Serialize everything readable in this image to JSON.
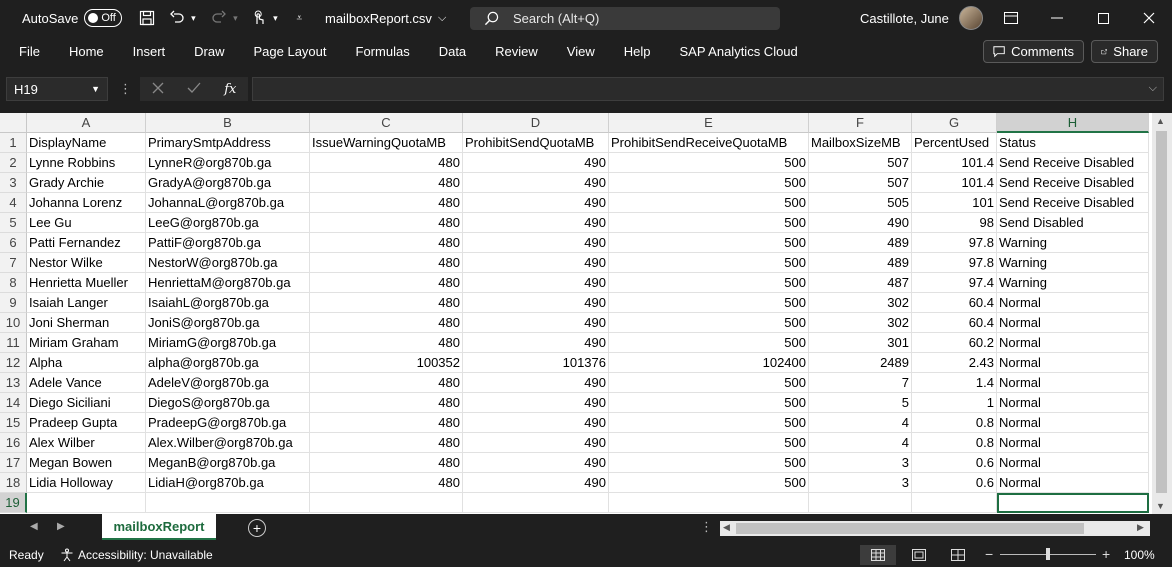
{
  "titlebar": {
    "autosave_label": "AutoSave",
    "autosave_state": "Off",
    "filename": "mailboxReport.csv",
    "search_placeholder": "Search (Alt+Q)",
    "user_name": "Castillote, June"
  },
  "menu": {
    "items": [
      "File",
      "Home",
      "Insert",
      "Draw",
      "Page Layout",
      "Formulas",
      "Data",
      "Review",
      "View",
      "Help",
      "SAP Analytics Cloud"
    ],
    "comments_label": "Comments",
    "share_label": "Share"
  },
  "formula_bar": {
    "name_box": "H19",
    "formula": ""
  },
  "sheet": {
    "columns": [
      "A",
      "B",
      "C",
      "D",
      "E",
      "F",
      "G",
      "H"
    ],
    "selected_column": "H",
    "row_numbers": [
      "1",
      "2",
      "3",
      "4",
      "5",
      "6",
      "7",
      "8",
      "9",
      "10",
      "11",
      "12",
      "13",
      "14",
      "15",
      "16",
      "17",
      "18",
      "19"
    ],
    "selected_row": "19",
    "rows": [
      [
        "DisplayName",
        "PrimarySmtpAddress",
        "IssueWarningQuotaMB",
        "ProhibitSendQuotaMB",
        "ProhibitSendReceiveQuotaMB",
        "MailboxSizeMB",
        "PercentUsed",
        "Status"
      ],
      [
        "Lynne Robbins",
        "LynneR@org870b.ga",
        "480",
        "490",
        "500",
        "507",
        "101.4",
        "Send Receive Disabled"
      ],
      [
        "Grady Archie",
        "GradyA@org870b.ga",
        "480",
        "490",
        "500",
        "507",
        "101.4",
        "Send Receive Disabled"
      ],
      [
        "Johanna Lorenz",
        "JohannaL@org870b.ga",
        "480",
        "490",
        "500",
        "505",
        "101",
        "Send Receive Disabled"
      ],
      [
        "Lee Gu",
        "LeeG@org870b.ga",
        "480",
        "490",
        "500",
        "490",
        "98",
        "Send Disabled"
      ],
      [
        "Patti Fernandez",
        "PattiF@org870b.ga",
        "480",
        "490",
        "500",
        "489",
        "97.8",
        "Warning"
      ],
      [
        "Nestor Wilke",
        "NestorW@org870b.ga",
        "480",
        "490",
        "500",
        "489",
        "97.8",
        "Warning"
      ],
      [
        "Henrietta Mueller",
        "HenriettaM@org870b.ga",
        "480",
        "490",
        "500",
        "487",
        "97.4",
        "Warning"
      ],
      [
        "Isaiah Langer",
        "IsaiahL@org870b.ga",
        "480",
        "490",
        "500",
        "302",
        "60.4",
        "Normal"
      ],
      [
        "Joni Sherman",
        "JoniS@org870b.ga",
        "480",
        "490",
        "500",
        "302",
        "60.4",
        "Normal"
      ],
      [
        "Miriam Graham",
        "MiriamG@org870b.ga",
        "480",
        "490",
        "500",
        "301",
        "60.2",
        "Normal"
      ],
      [
        "Alpha",
        "alpha@org870b.ga",
        "100352",
        "101376",
        "102400",
        "2489",
        "2.43",
        "Normal"
      ],
      [
        "Adele Vance",
        "AdeleV@org870b.ga",
        "480",
        "490",
        "500",
        "7",
        "1.4",
        "Normal"
      ],
      [
        "Diego Siciliani",
        "DiegoS@org870b.ga",
        "480",
        "490",
        "500",
        "5",
        "1",
        "Normal"
      ],
      [
        "Pradeep Gupta",
        "PradeepG@org870b.ga",
        "480",
        "490",
        "500",
        "4",
        "0.8",
        "Normal"
      ],
      [
        "Alex Wilber",
        "Alex.Wilber@org870b.ga",
        "480",
        "490",
        "500",
        "4",
        "0.8",
        "Normal"
      ],
      [
        "Megan Bowen",
        "MeganB@org870b.ga",
        "480",
        "490",
        "500",
        "3",
        "0.6",
        "Normal"
      ],
      [
        "Lidia Holloway",
        "LidiaH@org870b.ga",
        "480",
        "490",
        "500",
        "3",
        "0.6",
        "Normal"
      ],
      [
        "",
        "",
        "",
        "",
        "",
        "",
        "",
        ""
      ]
    ]
  },
  "tabs": {
    "sheet_name": "mailboxReport"
  },
  "status": {
    "ready": "Ready",
    "accessibility": "Accessibility: Unavailable",
    "zoom": "100%"
  },
  "colors": {
    "accent": "#217346",
    "chrome": "#1f1f1f"
  }
}
